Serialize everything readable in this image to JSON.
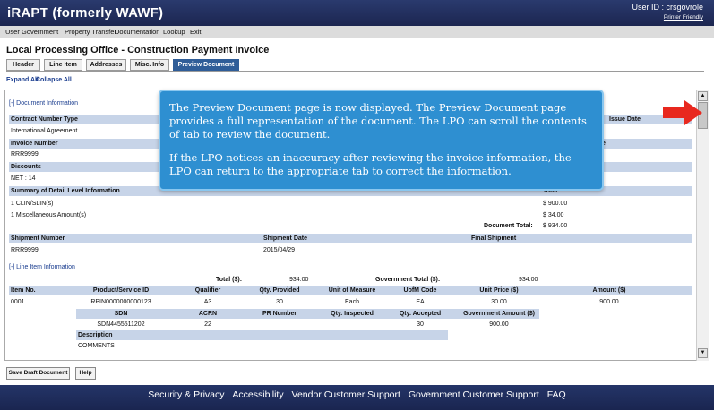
{
  "header": {
    "app_title": "iRAPT (formerly WAWF)",
    "user_id": "User ID : crsgovrole",
    "printer_friendly": "Printer Friendly"
  },
  "menu": [
    "User",
    "Government",
    "Property Transfer",
    "Documentation",
    "Lookup",
    "Exit"
  ],
  "page_title": "Local Processing Office - Construction Payment Invoice",
  "tabs": [
    "Header",
    "Line Item",
    "Addresses",
    "Misc. Info",
    "Preview Document"
  ],
  "active_tab": "Preview Document",
  "expand_all": "Expand All",
  "collapse_all": "Collapse All",
  "document_info": {
    "section_label": "[-] Document Information",
    "contract_number_type_label": "Contract Number Type",
    "contract_number_type_value": "International Agreement",
    "issue_date_label": "Issue Date",
    "invoice_number_label": "Invoice Number",
    "invoice_number_value": "RRR9999",
    "invoice_date_partial": "e",
    "discounts_label": "Discounts",
    "discounts_value": "NET : 14",
    "summary_label": "Summary of Detail Level Information",
    "total_label": "Total",
    "clin_label": "1 CLIN/SLIN(s)",
    "clin_total": "$ 900.00",
    "misc_label": "1 Miscellaneous Amount(s)",
    "misc_total": "$ 34.00",
    "document_total_label": "Document Total:",
    "document_total_value": "$ 934.00",
    "shipment_number_label": "Shipment Number",
    "shipment_number_value": "RRR9999",
    "shipment_date_label": "Shipment Date",
    "shipment_date_value": "2015/04/29",
    "final_shipment_label": "Final Shipment"
  },
  "line_items": {
    "section_label": "[-] Line Item Information",
    "total_label": "Total ($):",
    "total_value": "934.00",
    "gov_total_label": "Government Total ($):",
    "gov_total_value": "934.00",
    "headers_row1": [
      "Item No.",
      "Product/Service ID",
      "Qualifier",
      "Qty. Provided",
      "Unit of Measure",
      "UofM Code",
      "Unit Price ($)",
      "Amount ($)"
    ],
    "row1": [
      "0001",
      "RPIN0000000000123",
      "A3",
      "30",
      "Each",
      "EA",
      "30.00",
      "900.00"
    ],
    "headers_row2": [
      "SDN",
      "ACRN",
      "PR Number",
      "Qty. Inspected",
      "Qty. Accepted",
      "Government Amount ($)"
    ],
    "row2": [
      "SDN4455511202",
      "22",
      "",
      "",
      "30",
      "900.00"
    ],
    "description_label": "Description",
    "description_value": "COMMENTS"
  },
  "buttons": {
    "save_draft": "Save Draft Document",
    "help": "Help"
  },
  "footer": [
    "Security & Privacy",
    "Accessibility",
    "Vendor Customer Support",
    "Government Customer Support",
    "FAQ"
  ],
  "callout": {
    "para1": "The Preview Document page is now displayed. The Preview Document page provides a full representation of the document.  The LPO can scroll the contents of tab to review the document.",
    "para2": "If the LPO notices an inaccuracy after reviewing the invoice information, the LPO can return to the appropriate tab to correct the information."
  },
  "colors": {
    "header_bg": "#1c2650",
    "active_tab": "#2f5d98",
    "section_header": "#c7d4e8",
    "callout_bg": "#2e8fd1",
    "arrow": "#e8281e"
  },
  "icons": [
    "scroll-up-icon",
    "scroll-down-icon",
    "red-arrow-icon"
  ]
}
